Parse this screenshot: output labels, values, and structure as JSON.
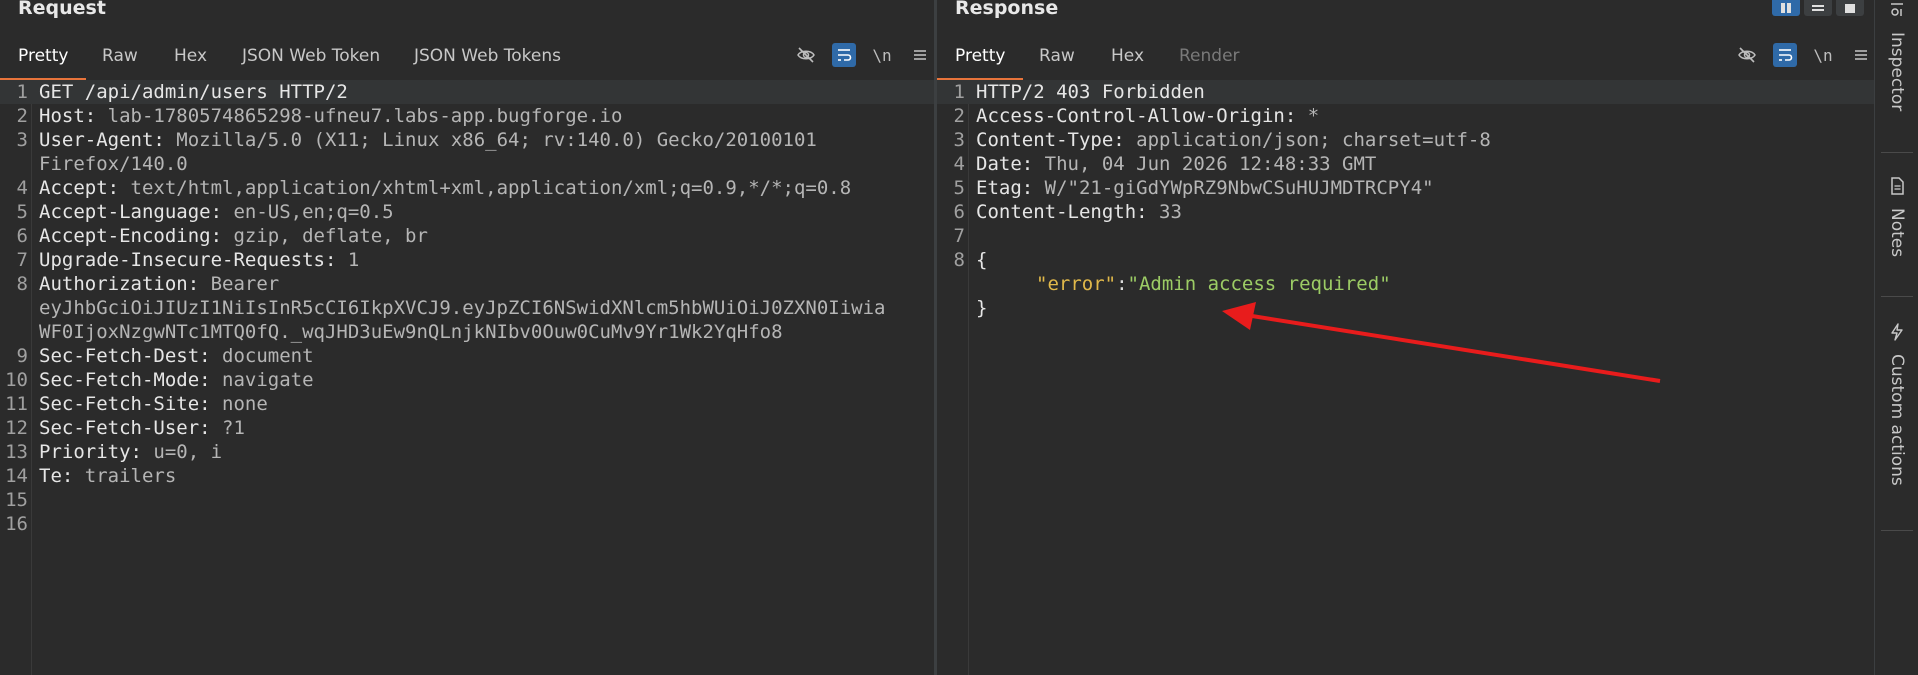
{
  "request": {
    "title": "Request",
    "tabs": [
      {
        "label": "Pretty",
        "active": true
      },
      {
        "label": "Raw"
      },
      {
        "label": "Hex"
      },
      {
        "label": "JSON Web Token"
      },
      {
        "label": "JSON Web Tokens"
      }
    ],
    "newline_label": "\\n",
    "lines": [
      {
        "num": "1",
        "key": "GET /api/admin/users HTTP/2",
        "val": ""
      },
      {
        "num": "2",
        "key": "Host:",
        "val": " lab-1780574865298-ufneu7.labs-app.bugforge.io"
      },
      {
        "num": "3",
        "key": "User-Agent:",
        "val": " Mozilla/5.0 (X11; Linux x86_64; rv:140.0) Gecko/20100101"
      },
      {
        "num": "",
        "key": "",
        "val": "Firefox/140.0"
      },
      {
        "num": "4",
        "key": "Accept:",
        "val": " text/html,application/xhtml+xml,application/xml;q=0.9,*/*;q=0.8"
      },
      {
        "num": "5",
        "key": "Accept-Language:",
        "val": " en-US,en;q=0.5"
      },
      {
        "num": "6",
        "key": "Accept-Encoding:",
        "val": " gzip, deflate, br"
      },
      {
        "num": "7",
        "key": "Upgrade-Insecure-Requests:",
        "val": " 1"
      },
      {
        "num": "8",
        "key": "Authorization:",
        "val": " Bearer"
      },
      {
        "num": "",
        "key": "",
        "val": "eyJhbGciOiJIUzI1NiIsInR5cCI6IkpXVCJ9.eyJpZCI6NSwidXNlcm5hbWUiOiJ0ZXN0Iiwia"
      },
      {
        "num": "",
        "key": "",
        "val": "WF0IjoxNzgwNTc1MTQ0fQ._wqJHD3uEw9nQLnjkNIbv0Ouw0CuMv9Yr1Wk2YqHfo8"
      },
      {
        "num": "9",
        "key": "Sec-Fetch-Dest:",
        "val": " document"
      },
      {
        "num": "10",
        "key": "Sec-Fetch-Mode:",
        "val": " navigate"
      },
      {
        "num": "11",
        "key": "Sec-Fetch-Site:",
        "val": " none"
      },
      {
        "num": "12",
        "key": "Sec-Fetch-User:",
        "val": " ?1"
      },
      {
        "num": "13",
        "key": "Priority:",
        "val": " u=0, i"
      },
      {
        "num": "14",
        "key": "Te:",
        "val": " trailers"
      },
      {
        "num": "15",
        "key": "",
        "val": ""
      },
      {
        "num": "16",
        "key": "",
        "val": ""
      }
    ]
  },
  "response": {
    "title": "Response",
    "tabs": [
      {
        "label": "Pretty",
        "active": true
      },
      {
        "label": "Raw"
      },
      {
        "label": "Hex"
      },
      {
        "label": "Render",
        "disabled": true
      }
    ],
    "newline_label": "\\n",
    "lines": [
      {
        "num": "1",
        "key": "HTTP/2 403 Forbidden",
        "val": ""
      },
      {
        "num": "2",
        "key": "Access-Control-Allow-Origin:",
        "val": " *"
      },
      {
        "num": "3",
        "key": "Content-Type:",
        "val": " application/json; charset=utf-8"
      },
      {
        "num": "4",
        "key": "Date:",
        "val": " Thu, 04 Jun 2026 12:48:33 GMT"
      },
      {
        "num": "5",
        "key": "Etag:",
        "val": " W/\"21-giGdYWpRZ9NbwCSuHUJMDTRCPY4\""
      },
      {
        "num": "6",
        "key": "Content-Length:",
        "val": " 33"
      },
      {
        "num": "7",
        "key": "",
        "val": ""
      },
      {
        "num": "8",
        "key": "{",
        "val": ""
      },
      {
        "num": "",
        "json_key": "\"error\"",
        "json_colon": ":",
        "json_val": "\"Admin access required\""
      },
      {
        "num": "",
        "key": "}",
        "val": ""
      }
    ]
  },
  "sidebar": {
    "items": [
      {
        "label": "Inspector",
        "icon": "inspector-icon"
      },
      {
        "label": "Notes",
        "icon": "notes-icon"
      },
      {
        "label": "Custom actions",
        "icon": "lightning-icon"
      }
    ]
  },
  "colors": {
    "accent": "#e8743b",
    "toggle_on": "#2f6aa8",
    "annotation_arrow": "#e81c1c"
  }
}
